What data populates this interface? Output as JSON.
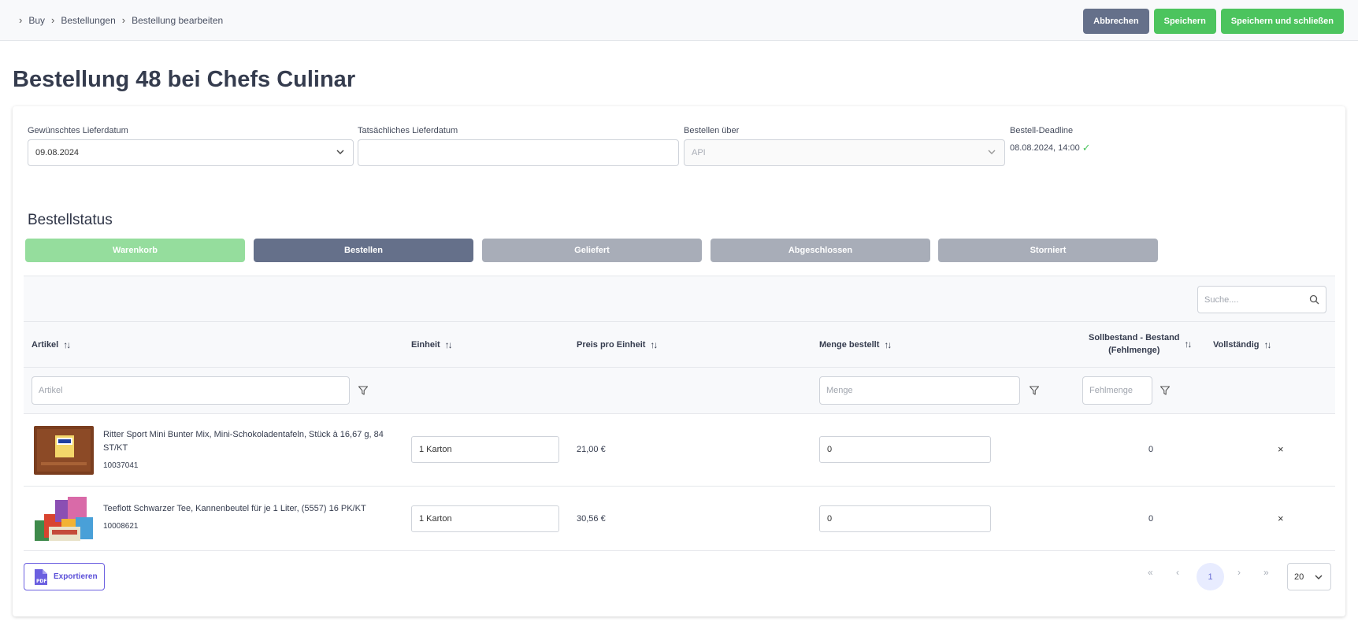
{
  "breadcrumb": [
    "Buy",
    "Bestellungen",
    "Bestellung bearbeiten"
  ],
  "actions": {
    "cancel": "Abbrechen",
    "save": "Speichern",
    "save_close": "Speichern und schließen"
  },
  "title": "Bestellung 48 bei Chefs Culinar",
  "fields": {
    "desired_label": "Gewünschtes Lieferdatum",
    "desired_value": "09.08.2024",
    "actual_label": "Tatsächliches Lieferdatum",
    "actual_value": "",
    "via_label": "Bestellen über",
    "via_value": "API",
    "deadline_label": "Bestell-Deadline",
    "deadline_value": "08.08.2024, 14:00"
  },
  "status": {
    "title": "Bestellstatus",
    "steps": [
      "Warenkorb",
      "Bestellen",
      "Geliefert",
      "Abgeschlossen",
      "Storniert"
    ]
  },
  "table": {
    "search_placeholder": "Suche....",
    "headers": {
      "article": "Artikel",
      "unit": "Einheit",
      "price": "Preis pro Einheit",
      "qty": "Menge bestellt",
      "shortage_1": "Sollbestand - Bestand",
      "shortage_2": "(Fehlmenge)",
      "complete": "Vollständig"
    },
    "filters": {
      "article": "Artikel",
      "qty": "Menge",
      "shortage": "Fehlmenge"
    },
    "rows": [
      {
        "name": "Ritter Sport Mini Bunter Mix, Mini-Schokoladentafeln, Stück à 16,67 g, 84 ST/KT",
        "number": "10037041",
        "unit": "1 Karton",
        "price": "21,00 €",
        "qty": "0",
        "shortage": "0",
        "complete": "×"
      },
      {
        "name": "Teeflott Schwarzer Tee, Kannenbeutel für je 1 Liter, (5557) 16 PK/KT",
        "number": "10008621",
        "unit": "1 Karton",
        "price": "30,56 €",
        "qty": "0",
        "shortage": "0",
        "complete": "×"
      }
    ]
  },
  "footer": {
    "export": "Exportieren",
    "pdf_badge": "PDF",
    "page": "1",
    "page_size": "20",
    "first": "«",
    "prev": "‹",
    "next": "›",
    "last": "»"
  },
  "colors": {
    "save": "#4cc45e",
    "cancel": "#65708a",
    "accent": "#5a4ed8"
  }
}
